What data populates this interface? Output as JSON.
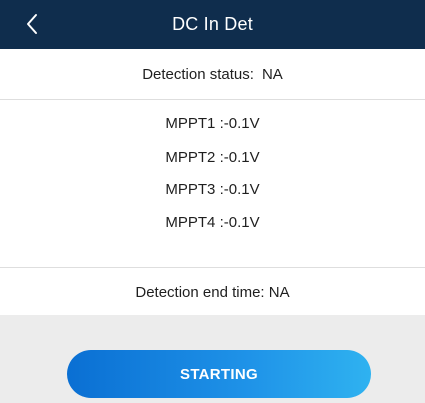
{
  "header": {
    "title": "DC In Det",
    "back_icon": "chevron-left-icon"
  },
  "status": {
    "label": "Detection status:",
    "value": "NA"
  },
  "mppt": [
    {
      "label": "MPPT1 :",
      "value": "-0.1V"
    },
    {
      "label": "MPPT2 :",
      "value": "-0.1V"
    },
    {
      "label": "MPPT3 :",
      "value": "-0.1V"
    },
    {
      "label": "MPPT4 :",
      "value": "-0.1V"
    }
  ],
  "end_time": {
    "label": "Detection end time:",
    "value": "NA"
  },
  "action": {
    "button_label": "STARTING"
  },
  "colors": {
    "header_bg": "#0f2d4d",
    "button_start": "#0a6fd3",
    "button_end": "#2fb2f0",
    "bottom_bg": "#ececec"
  }
}
